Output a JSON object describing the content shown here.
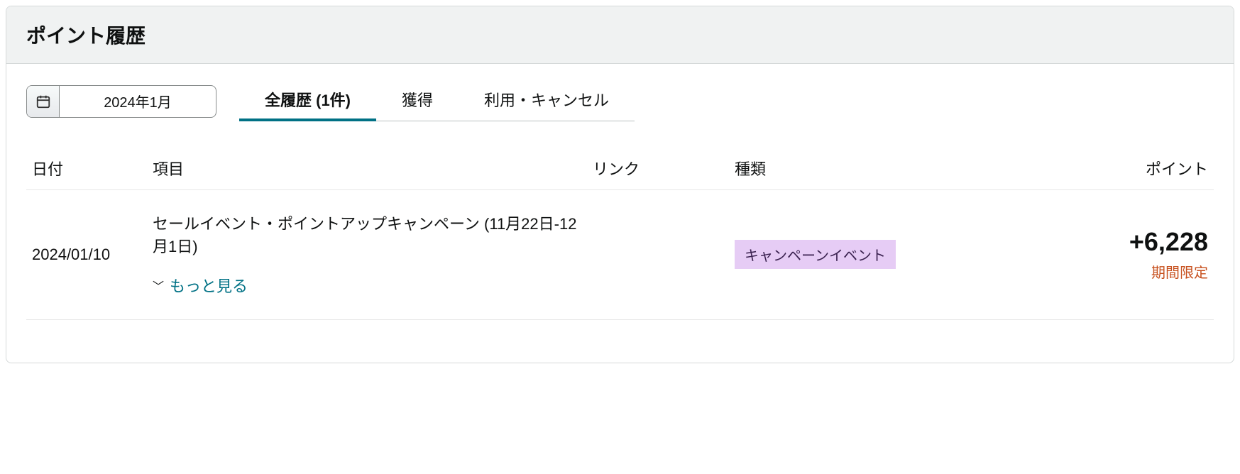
{
  "header": {
    "title": "ポイント履歴"
  },
  "datePicker": {
    "value": "2024年1月"
  },
  "tabs": {
    "all": {
      "label": "全履歴 (1件)"
    },
    "earned": {
      "label": "獲得"
    },
    "used": {
      "label": "利用・キャンセル"
    }
  },
  "columns": {
    "date": "日付",
    "item": "項目",
    "link": "リンク",
    "type": "種類",
    "points": "ポイント"
  },
  "rows": [
    {
      "date": "2024/01/10",
      "item": "セールイベント・ポイントアップキャンペーン (11月22日-12月1日)",
      "seeMore": "もっと見る",
      "link": "",
      "typeBadge": "キャンペーンイベント",
      "points": "+6,228",
      "pointsNote": "期間限定"
    }
  ]
}
